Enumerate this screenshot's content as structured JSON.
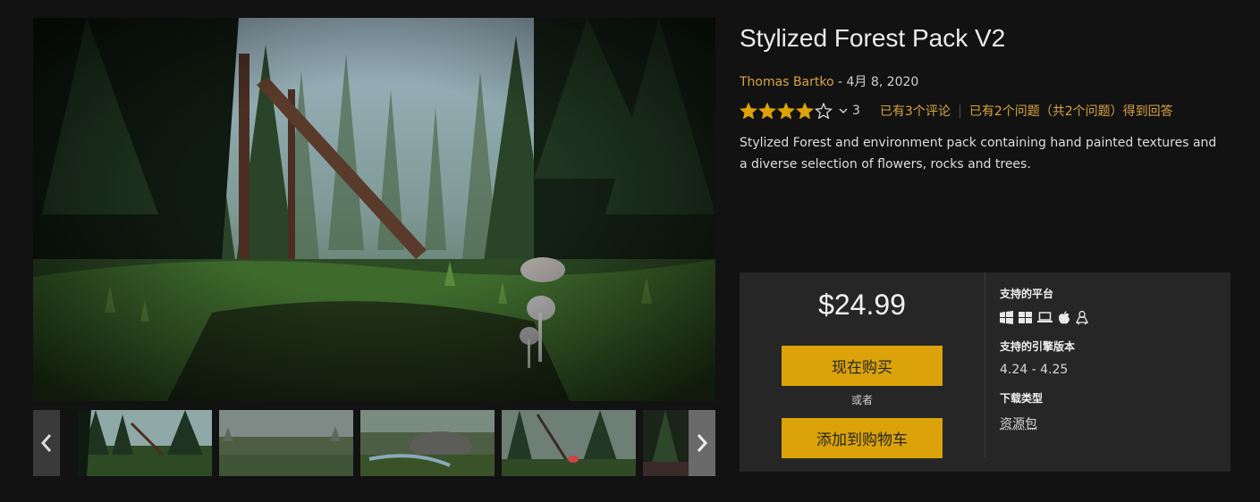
{
  "product": {
    "title": "Stylized Forest Pack V2",
    "author": "Thomas Bartko",
    "date_sep": " - ",
    "date": "4月 8, 2020",
    "rating": 4,
    "rating_max": 5,
    "rating_count": "3",
    "reviews_link": "已有3个评论",
    "questions_link": "已有2个问题（共2个问题）得到回答",
    "description": "Stylized Forest and environment pack containing hand painted textures and a diverse selection of flowers, rocks and trees."
  },
  "purchase": {
    "price": "$24.99",
    "buy_now": "现在购买",
    "or": "或者",
    "add_to_cart": "添加到购物车"
  },
  "info": {
    "platforms_label": "支持的平台",
    "platforms": [
      "windows-icon",
      "windows-icon",
      "laptop-icon",
      "apple-icon",
      "linux-icon"
    ],
    "engine_label": "支持的引擎版本",
    "engine_versions": "4.24 - 4.25",
    "download_label": "下载类型",
    "download_type": "资源包"
  },
  "gallery": {
    "thumbnails": [
      "forest-screenshot-1",
      "meadow-screenshot-2",
      "rocks-screenshot-3",
      "forest-screenshot-4",
      "forest-screenshot-5"
    ]
  },
  "colors": {
    "accent": "#dba20a",
    "link": "#d9a441",
    "background": "#121212",
    "panel": "#262626"
  }
}
